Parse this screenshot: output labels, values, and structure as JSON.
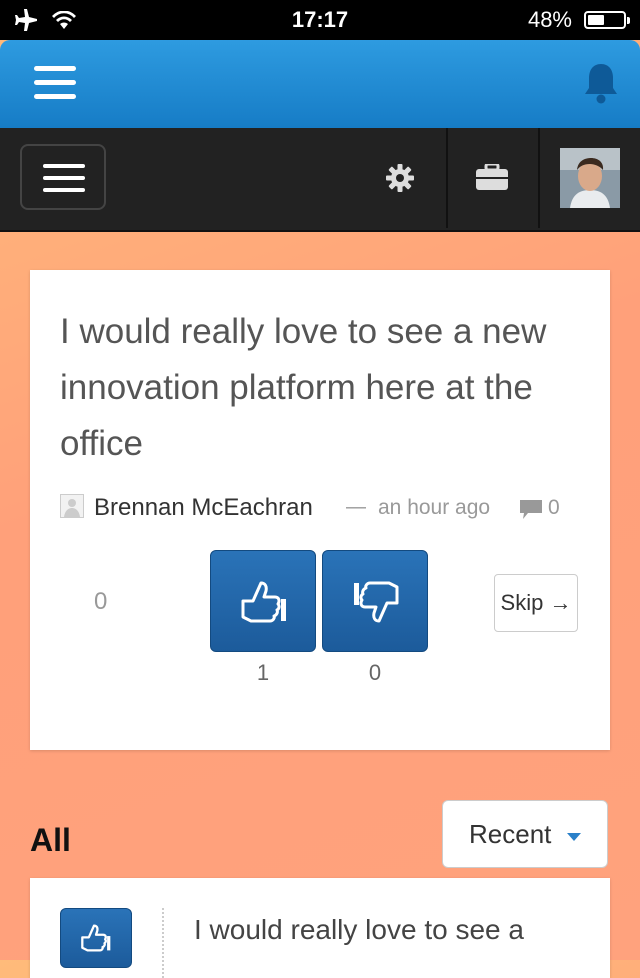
{
  "status_bar": {
    "time": "17:17",
    "battery_percent": "48%",
    "battery_level": 0.48
  },
  "header": {
    "menu_icon": "hamburger-icon",
    "notification_icon": "bell-icon"
  },
  "nav": {
    "settings_icon": "gear-icon",
    "portfolio_icon": "briefcase-icon",
    "avatar": "user-avatar"
  },
  "idea": {
    "text": "I would really love to see a new innovation platform here at the office",
    "author": "Brennan McEachran",
    "separator": "—",
    "time_ago": "an hour ago",
    "comment_count": "0",
    "score": "0",
    "upvotes": "1",
    "downvotes": "0",
    "skip_label": "Skip →"
  },
  "list": {
    "section_title": "All",
    "sort_label": "Recent",
    "first_item_text": "I would really love to see a"
  },
  "colors": {
    "accent": "#1e6fb5",
    "header_blue": "#2589d4",
    "nav_dark": "#222222"
  }
}
